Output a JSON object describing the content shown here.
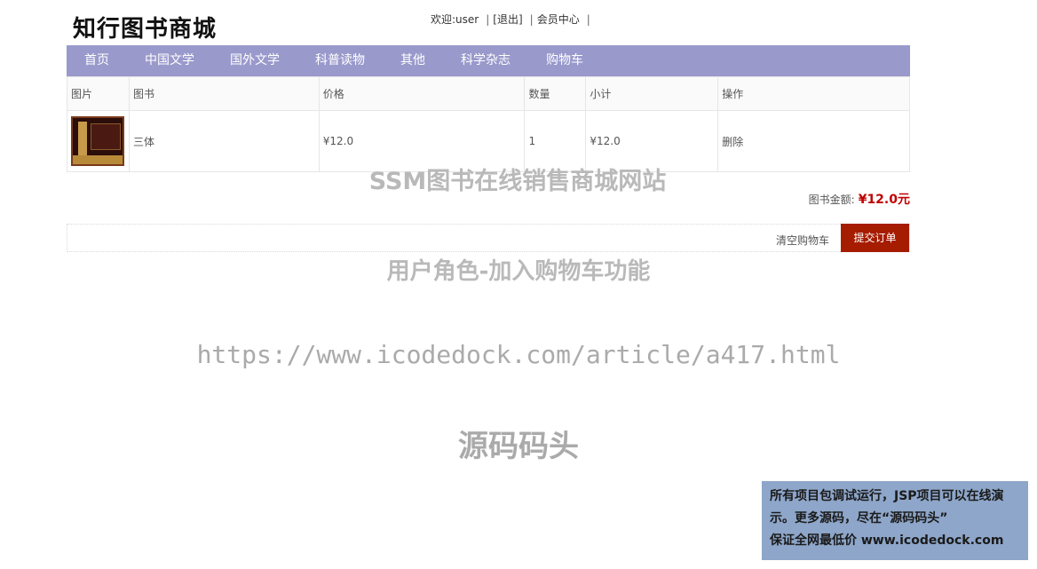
{
  "header": {
    "logo": "知行图书商城",
    "welcome": "欢迎:user",
    "logout": "[退出]",
    "member_center": "会员中心",
    "sep": "|"
  },
  "nav": {
    "items": [
      {
        "label": "首页"
      },
      {
        "label": "中国文学"
      },
      {
        "label": "国外文学"
      },
      {
        "label": "科普读物"
      },
      {
        "label": "其他"
      },
      {
        "label": "科学杂志"
      },
      {
        "label": "购物车"
      }
    ]
  },
  "cart": {
    "headers": [
      "图片",
      "图书",
      "价格",
      "数量",
      "小计",
      "操作"
    ],
    "rows": [
      {
        "title": "三体",
        "price": "¥12.0",
        "quantity": "1",
        "subtotal": "¥12.0",
        "action": "删除"
      }
    ],
    "total_label": "图书金额:",
    "total_value": "¥12.0元",
    "clear_label": "清空购物车",
    "submit_label": "提交订单"
  },
  "watermarks": {
    "line1": "SSM图书在线销售商城网站",
    "line2": "用户角色-加入购物车功能",
    "line3": "https://www.icodedock.com/article/a417.html",
    "line4": "源码码头"
  },
  "promo": {
    "line1": "所有项目包调试运行，JSP项目可以在线演",
    "line2": "示。更多源码，尽在“源码码头”",
    "line3": "保证全网最低价 www.icodedock.com"
  },
  "colors": {
    "nav_bg": "#9999cc",
    "submit_bg": "#a61c00",
    "total_color": "#c00000",
    "promo_bg": "#8da6c9"
  }
}
